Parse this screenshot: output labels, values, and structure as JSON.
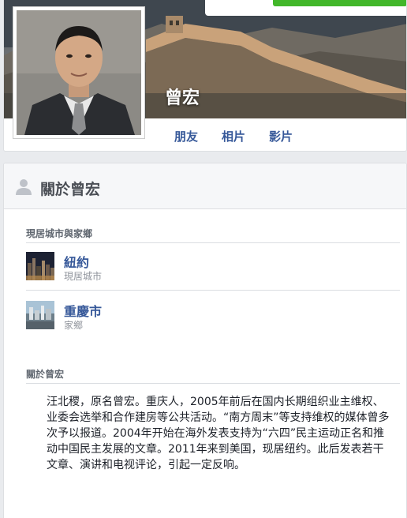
{
  "profile": {
    "name": "曾宏"
  },
  "nav": {
    "tabs": [
      "朋友",
      "相片",
      "影片"
    ]
  },
  "about": {
    "title": "關於曾宏",
    "places_label": "現居城市與家鄉",
    "places": [
      {
        "name": "紐約",
        "sub": "現居城市",
        "thumb_icon": "new-york-thumbnail"
      },
      {
        "name": "重慶市",
        "sub": "家鄉",
        "thumb_icon": "chongqing-thumbnail"
      }
    ],
    "bio_label": "關於曾宏",
    "bio": "汪北稷，原名曾宏。重庆人，2005年前后在国内长期组织业主维权、业委会选举和合作建房等公共活动。“南方周末”等支持维权的媒体曾多次予以报道。2004年开始在海外发表支持为“六四”民主运动正名和推动中国民主发展的文章。2011年来到美国，现居纽约。此后发表若干文章、演讲和电视评论，引起一定反响。"
  },
  "colors": {
    "link": "#365899",
    "green_button": "#42b72a",
    "page_bg": "#e9ebee"
  }
}
